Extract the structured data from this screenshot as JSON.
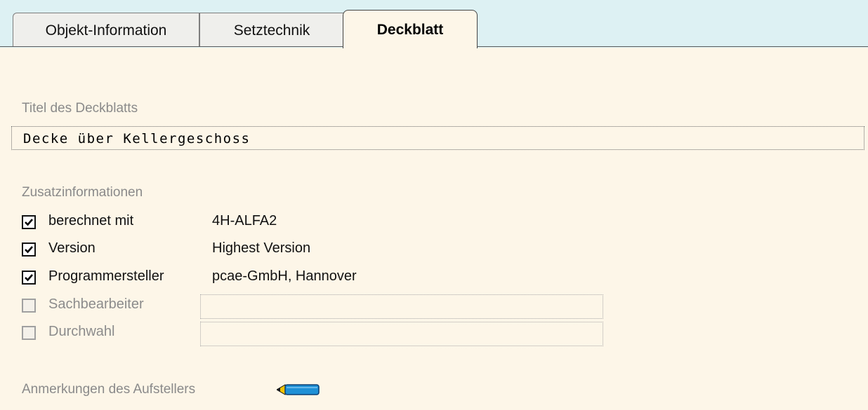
{
  "tabs": {
    "objekt_information": "Objekt-Information",
    "setztechnik": "Setztechnik",
    "deckblatt": "Deckblatt"
  },
  "titel": {
    "label": "Titel des Deckblatts",
    "value": "Decke über Kellergeschoss"
  },
  "zusatz": {
    "label": "Zusatzinformationen",
    "rows": [
      {
        "label": "berechnet mit",
        "checked": true,
        "value": "4H-ALFA2"
      },
      {
        "label": "Version",
        "checked": true,
        "value": "Highest Version"
      },
      {
        "label": "Programmersteller",
        "checked": true,
        "value": "pcae-GmbH, Hannover"
      },
      {
        "label": "Sachbearbeiter",
        "checked": false,
        "value": ""
      },
      {
        "label": "Durchwahl",
        "checked": false,
        "value": ""
      }
    ]
  },
  "anmerkungen": {
    "label": "Anmerkungen des Aufstellers",
    "icon": "pencil-icon"
  },
  "colors": {
    "tab_bar": "#ddf1f3",
    "background": "#fdf6e8",
    "label_gray": "#8a8a8a",
    "pencil_blue": "#1e90d6",
    "pencil_tip": "#f2c200"
  }
}
